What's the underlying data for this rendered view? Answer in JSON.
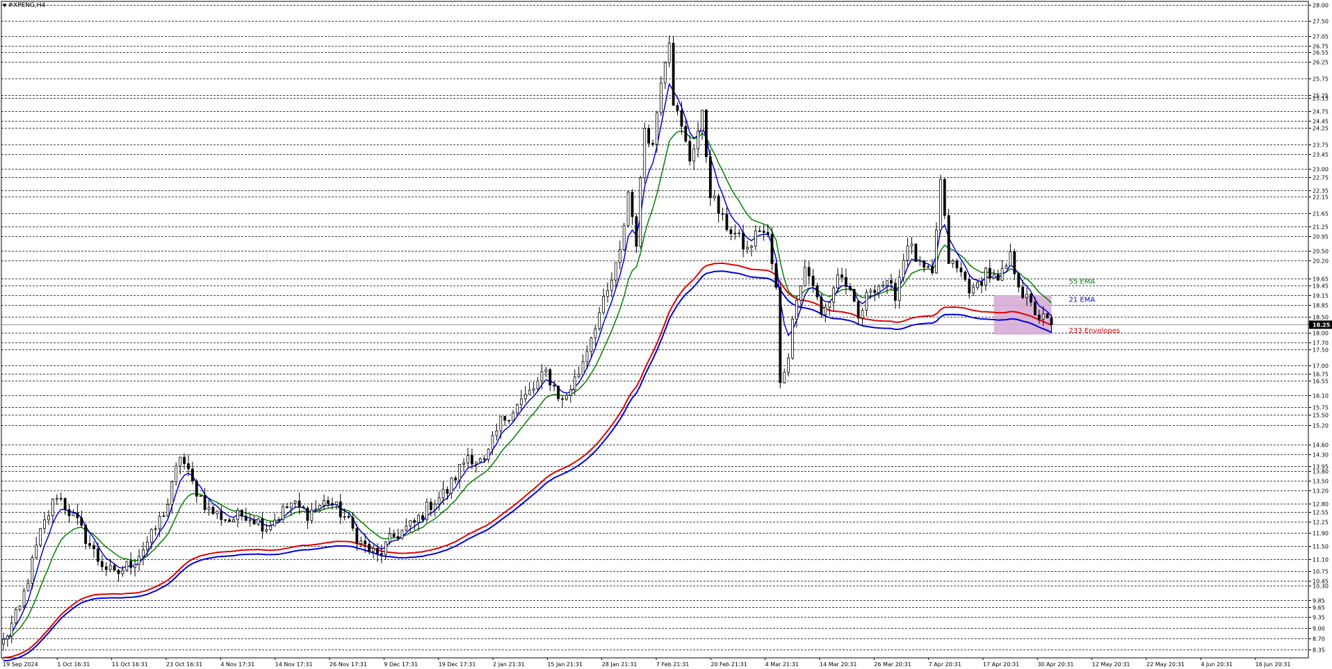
{
  "title": "#XPENG,H4",
  "colors": {
    "background": "#ffffff",
    "grid": "#000000",
    "candle": "#000000",
    "ema21": "#0000dd",
    "ema55": "#008000",
    "env_upper": "#e00000",
    "env_lower": "#0000dd",
    "highlight": "#d5a8d3",
    "price_box": "#000000"
  },
  "chart_data": {
    "type": "candlestick",
    "symbol": "#XPENG",
    "timeframe": "H4",
    "current_price": "18.25",
    "y_range": [
      8.1,
      28.1
    ],
    "y_tick_labels": [
      "28.00",
      "27.50",
      "27.05",
      "26.75",
      "26.55",
      "26.25",
      "25.75",
      "25.25",
      "25.15",
      "24.75",
      "24.45",
      "24.25",
      "23.75",
      "23.45",
      "23.00",
      "22.75",
      "22.35",
      "22.15",
      "21.65",
      "21.25",
      "20.95",
      "20.50",
      "20.20",
      "19.65",
      "19.45",
      "19.15",
      "18.85",
      "18.50",
      "18.25",
      "18.00",
      "17.70",
      "17.50",
      "17.00",
      "16.75",
      "16.55",
      "16.10",
      "15.75",
      "15.50",
      "15.20",
      "14.60",
      "14.30",
      "13.95",
      "13.80",
      "13.50",
      "13.20",
      "12.80",
      "12.55",
      "12.25",
      "11.90",
      "11.50",
      "11.10",
      "10.75",
      "10.45",
      "10.30",
      "9.85",
      "9.65",
      "9.35",
      "9.00",
      "8.70",
      "8.35"
    ],
    "x_labels": [
      "19 Sep 2024",
      "1 Oct 16:31",
      "11 Oct 16:31",
      "23 Oct 16:31",
      "4 Nov 17:31",
      "14 Nov 17:31",
      "26 Nov 17:31",
      "9 Dec 17:31",
      "19 Dec 17:31",
      "2 Jan 21:31",
      "15 Jan 21:31",
      "28 Jan 21:31",
      "7 Feb 21:31",
      "20 Feb 21:31",
      "4 Mar 21:31",
      "14 Mar 20:31",
      "26 Mar 20:31",
      "7 Apr 20:31",
      "17 Apr 20:31",
      "30 Apr 20:31",
      "12 May 20:31",
      "22 May 20:31",
      "4 Jun 20:31",
      "16 Jun 20:31"
    ],
    "price_path": [
      [
        0,
        8.6
      ],
      [
        4,
        9.6
      ],
      [
        9,
        11.9
      ],
      [
        13,
        13.1
      ],
      [
        18,
        12.2
      ],
      [
        23,
        11.1
      ],
      [
        27,
        10.6
      ],
      [
        32,
        11.1
      ],
      [
        36,
        11.8
      ],
      [
        40,
        12.8
      ],
      [
        43,
        14.3
      ],
      [
        46,
        13.4
      ],
      [
        50,
        12.6
      ],
      [
        55,
        12.3
      ],
      [
        59,
        12.5
      ],
      [
        64,
        12.1
      ],
      [
        70,
        12.8
      ],
      [
        74,
        12.5
      ],
      [
        79,
        12.9
      ],
      [
        83,
        12.4
      ],
      [
        87,
        11.6
      ],
      [
        91,
        11.2
      ],
      [
        95,
        11.8
      ],
      [
        100,
        12.2
      ],
      [
        104,
        12.8
      ],
      [
        108,
        13.2
      ],
      [
        113,
        14.3
      ],
      [
        117,
        14.0
      ],
      [
        121,
        15.3
      ],
      [
        125,
        15.8
      ],
      [
        129,
        16.3
      ],
      [
        132,
        16.8
      ],
      [
        136,
        15.9
      ],
      [
        140,
        16.8
      ],
      [
        144,
        18.3
      ],
      [
        147,
        19.2
      ],
      [
        150,
        20.4
      ],
      [
        152,
        22.3
      ],
      [
        154,
        20.8
      ],
      [
        156,
        24.3
      ],
      [
        158,
        23.7
      ],
      [
        160,
        25.8
      ],
      [
        162,
        27.0
      ],
      [
        163,
        25.1
      ],
      [
        165,
        24.2
      ],
      [
        167,
        23.3
      ],
      [
        170,
        24.6
      ],
      [
        172,
        22.3
      ],
      [
        175,
        21.4
      ],
      [
        178,
        21.0
      ],
      [
        181,
        20.5
      ],
      [
        184,
        21.2
      ],
      [
        186,
        20.9
      ],
      [
        188,
        19.3
      ],
      [
        189,
        16.4
      ],
      [
        191,
        17.4
      ],
      [
        193,
        19.2
      ],
      [
        195,
        20.0
      ],
      [
        197,
        19.5
      ],
      [
        199,
        18.5
      ],
      [
        201,
        19.0
      ],
      [
        203,
        19.8
      ],
      [
        205,
        19.5
      ],
      [
        208,
        18.4
      ],
      [
        211,
        19.4
      ],
      [
        214,
        19.5
      ],
      [
        217,
        19.2
      ],
      [
        220,
        20.8
      ],
      [
        223,
        20.0
      ],
      [
        226,
        19.7
      ],
      [
        228,
        22.6
      ],
      [
        230,
        20.2
      ],
      [
        233,
        19.8
      ],
      [
        236,
        19.2
      ],
      [
        239,
        19.9
      ],
      [
        242,
        19.5
      ],
      [
        245,
        20.3
      ],
      [
        248,
        19.2
      ],
      [
        250,
        18.8
      ],
      [
        252,
        18.5
      ],
      [
        255,
        18.25
      ]
    ],
    "indicators": {
      "ema21": {
        "label": "21 EMA",
        "color": "#0000dd"
      },
      "ema55": {
        "label": "55 EMA",
        "color": "#008000"
      },
      "env233": {
        "label": "233 Envelopes",
        "colors": [
          "#e00000",
          "#0000dd"
        ]
      }
    },
    "highlight_zone": {
      "from_bar": 241,
      "to_bar": 255,
      "top": 19.15,
      "bottom": 17.95
    }
  }
}
